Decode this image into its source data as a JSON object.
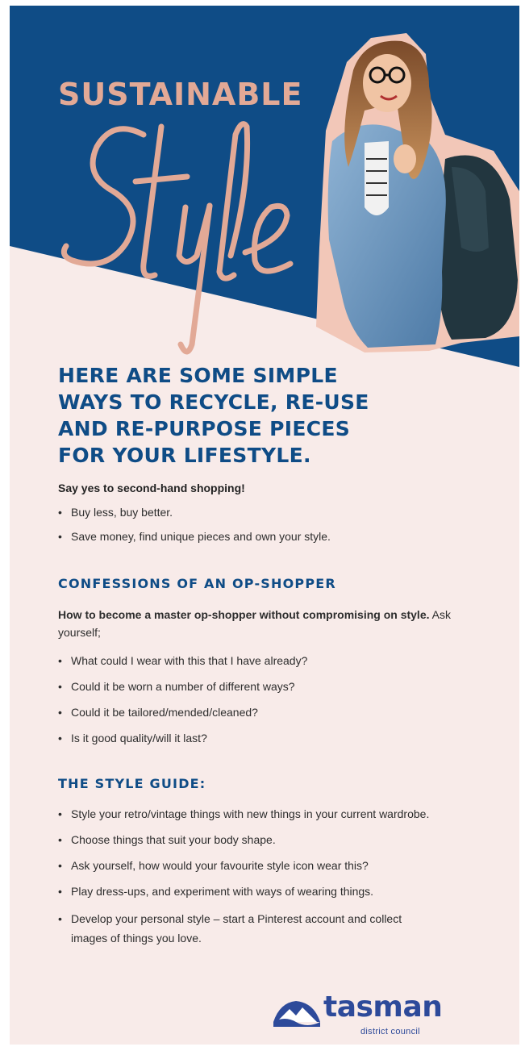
{
  "hero": {
    "title_top": "SUSTAINABLE",
    "title_script": "Style",
    "photo_icon": "woman-with-backpack-photo"
  },
  "headline": "HERE ARE SOME SIMPLE WAYS TO RECYCLE, RE-USE AND RE-PURPOSE PIECES FOR YOUR LIFESTYLE.",
  "intro": {
    "lead": "Say yes to second-hand shopping!",
    "items": [
      "Buy less, buy better.",
      "Save money, find unique pieces and own your style."
    ]
  },
  "confessions": {
    "heading": "CONFESSIONS OF AN OP-SHOPPER",
    "lead_bold": "How to become a master op-shopper without compromising on style.",
    "lead_rest": " Ask yourself;",
    "items": [
      "What could I wear with this that I have already?",
      "Could it be worn a number of different ways?",
      "Could it be tailored/mended/cleaned?",
      "Is it good quality/will it last?"
    ]
  },
  "style_guide": {
    "heading": "THE STYLE GUIDE:",
    "items": [
      "Style your retro/vintage things with new things in your current wardrobe.",
      "Choose things that suit your body shape.",
      "Ask yourself, how would your favourite style icon wear this?",
      "Play dress-ups, and experiment with ways of wearing things.",
      "Develop your personal style – start a Pinterest account and collect images of things you love."
    ]
  },
  "logo": {
    "word": "tasman",
    "sub": "district council",
    "icon": "mountain-logo-icon"
  },
  "colors": {
    "navy": "#0f4c86",
    "blush": "#f8ebe9",
    "rose_gold": "#e2a996",
    "logo_blue": "#2d4a9a"
  }
}
